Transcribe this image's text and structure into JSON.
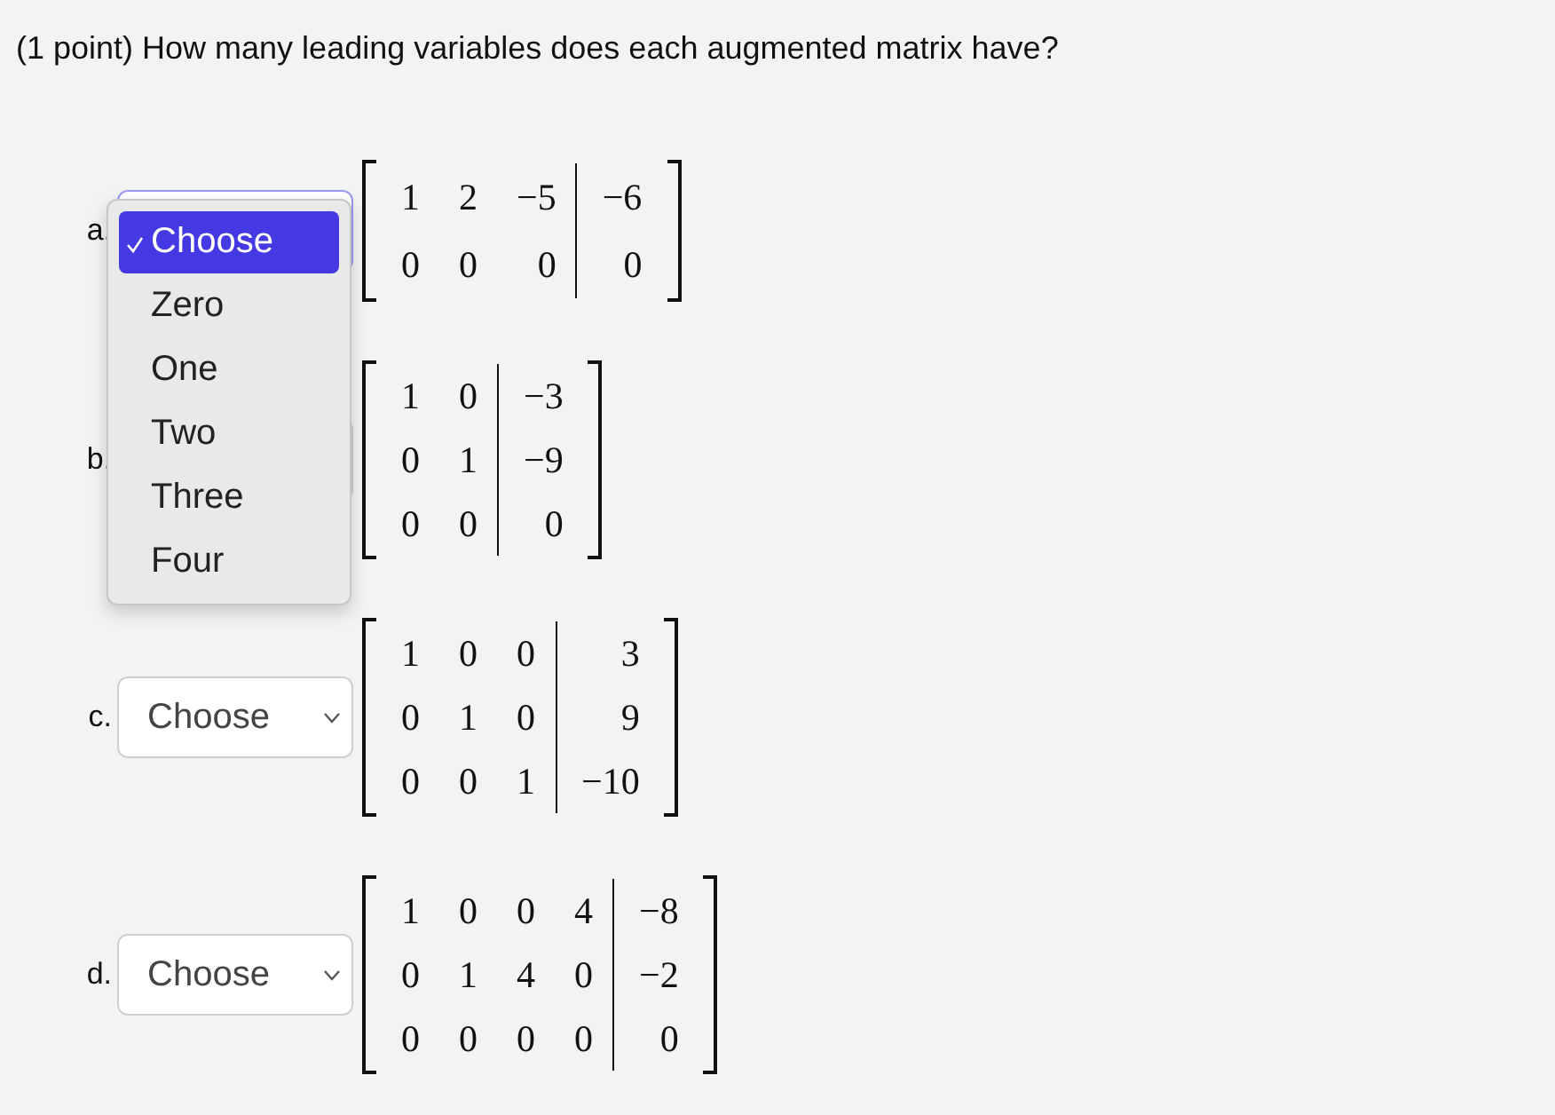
{
  "question": "(1 point) How many leading variables does each augmented matrix have?",
  "items": [
    {
      "label": "a.",
      "open": true,
      "matrix": {
        "rows": [
          [
            "1",
            "2",
            "−5",
            "−6"
          ],
          [
            "0",
            "0",
            "0",
            "0"
          ]
        ]
      }
    },
    {
      "label": "b.",
      "open": false,
      "matrix": {
        "rows": [
          [
            "1",
            "0",
            "−3"
          ],
          [
            "0",
            "1",
            "−9"
          ],
          [
            "0",
            "0",
            "0"
          ]
        ]
      }
    },
    {
      "label": "c.",
      "choice": "Choose",
      "open": false,
      "matrix": {
        "rows": [
          [
            "1",
            "0",
            "0",
            "3"
          ],
          [
            "0",
            "1",
            "0",
            "9"
          ],
          [
            "0",
            "0",
            "1",
            "−10"
          ]
        ]
      }
    },
    {
      "label": "d.",
      "choice": "Choose",
      "open": false,
      "matrix": {
        "rows": [
          [
            "1",
            "0",
            "0",
            "4",
            "−8"
          ],
          [
            "0",
            "1",
            "4",
            "0",
            "−2"
          ],
          [
            "0",
            "0",
            "0",
            "0",
            "0"
          ]
        ]
      }
    }
  ],
  "dropdown_options": [
    {
      "label": "Choose",
      "selected": true
    },
    {
      "label": "Zero",
      "selected": false
    },
    {
      "label": "One",
      "selected": false
    },
    {
      "label": "Two",
      "selected": false
    },
    {
      "label": "Three",
      "selected": false
    },
    {
      "label": "Four",
      "selected": false
    }
  ]
}
